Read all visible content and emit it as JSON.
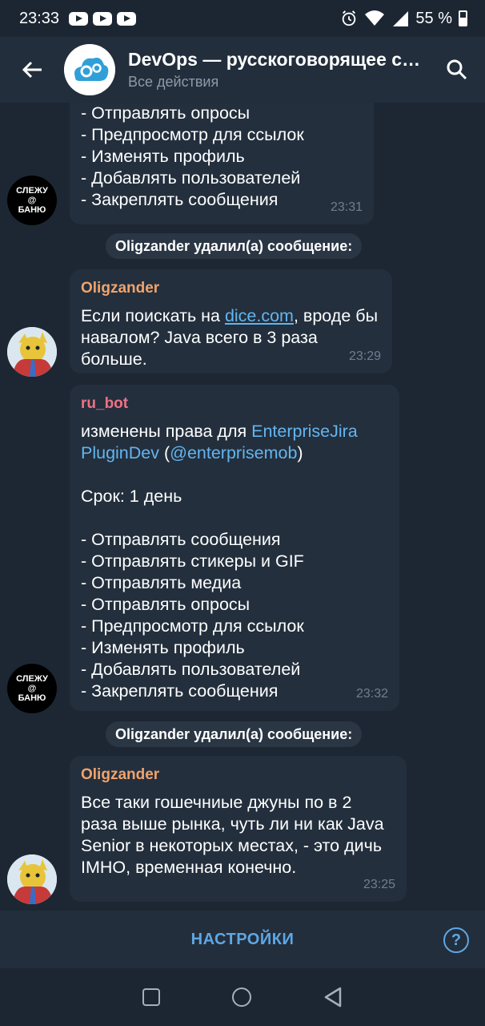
{
  "status_bar": {
    "time": "23:33",
    "battery": "55 %"
  },
  "header": {
    "title": "DevOps — русскоговорящее сообщество",
    "subtitle": "Все действия"
  },
  "messages": [
    {
      "time": "23:31",
      "lines": [
        "- Отправлять опросы",
        "- Предпросмотр для ссылок",
        "- Изменять профиль",
        "- Добавлять пользователей",
        "- Закреплять сообщения"
      ]
    },
    {
      "service": "Oligzander удалил(а) сообщение:"
    },
    {
      "author": "Oligzander",
      "author_color": "#f0a36c",
      "text_before": "Если поискать на ",
      "link": "dice.com",
      "text_after": ", вроде бы навалом? Java всего в 3 раза больше.",
      "time": "23:29"
    },
    {
      "author": "ru_bot",
      "author_color": "#f07184",
      "text_before": "изменены права для ",
      "link": "EnterpriseJira PluginDev",
      "text_mid": " (",
      "handle": "@enterprisemob",
      "text_after": ")",
      "term": "Срок: 1 день",
      "lines": [
        "- Отправлять сообщения",
        "- Отправлять стикеры и GIF",
        "- Отправлять медиа",
        "- Отправлять опросы",
        "- Предпросмотр для ссылок",
        "- Изменять профиль",
        "- Добавлять пользователей",
        "- Закреплять сообщения"
      ],
      "time": "23:32"
    },
    {
      "service": "Oligzander удалил(а) сообщение:"
    },
    {
      "author": "Oligzander",
      "author_color": "#f0a36c",
      "text": "Все таки гошечниые джуны по в 2 раза выше рынка, чуть ли ни как Java Senior в некоторых местах,  - это дичь IMHO, временная конечно.",
      "time": "23:25"
    }
  ],
  "avatars": {
    "slezhu_lines": [
      "СЛЕЖУ",
      "@",
      "БАНЮ"
    ]
  },
  "bottom_bar": {
    "settings_label": "НАСТРОЙКИ",
    "help_symbol": "?"
  },
  "colors": {
    "accent": "#5ea7e4",
    "link": "#64b5ef",
    "bubble": "#232f3d",
    "background": "#1d2733"
  }
}
